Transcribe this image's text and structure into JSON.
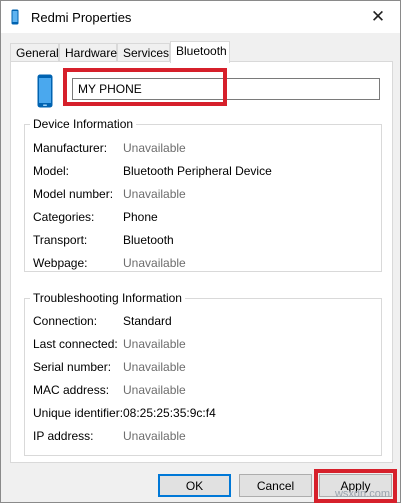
{
  "window": {
    "title": "Redmi Properties",
    "close_glyph": "✕"
  },
  "tabs": [
    {
      "label": "General"
    },
    {
      "label": "Hardware"
    },
    {
      "label": "Services"
    },
    {
      "label": "Bluetooth",
      "active": true
    }
  ],
  "device_name": {
    "value": "MY PHONE"
  },
  "device_info": {
    "title": "Device Information",
    "rows": [
      {
        "label": "Manufacturer:",
        "value": "Unavailable"
      },
      {
        "label": "Model:",
        "value": "Bluetooth Peripheral Device"
      },
      {
        "label": "Model number:",
        "value": "Unavailable"
      },
      {
        "label": "Categories:",
        "value": "Phone"
      },
      {
        "label": "Transport:",
        "value": "Bluetooth"
      },
      {
        "label": "Webpage:",
        "value": "Unavailable"
      }
    ]
  },
  "troubleshooting": {
    "title": "Troubleshooting Information",
    "rows": [
      {
        "label": "Connection:",
        "value": "Standard"
      },
      {
        "label": "Last connected:",
        "value": "Unavailable"
      },
      {
        "label": "Serial number:",
        "value": "Unavailable"
      },
      {
        "label": "MAC address:",
        "value": "Unavailable"
      },
      {
        "label": "Unique identifier:",
        "value": "08:25:25:35:9c:f4"
      },
      {
        "label": "IP address:",
        "value": "Unavailable"
      }
    ]
  },
  "buttons": {
    "ok": "OK",
    "cancel": "Cancel",
    "apply": "Apply"
  },
  "watermark": "wsxdn.com",
  "colors": {
    "highlight": "#d6202b",
    "accent": "#0078d7",
    "icon": "#0063b1"
  }
}
